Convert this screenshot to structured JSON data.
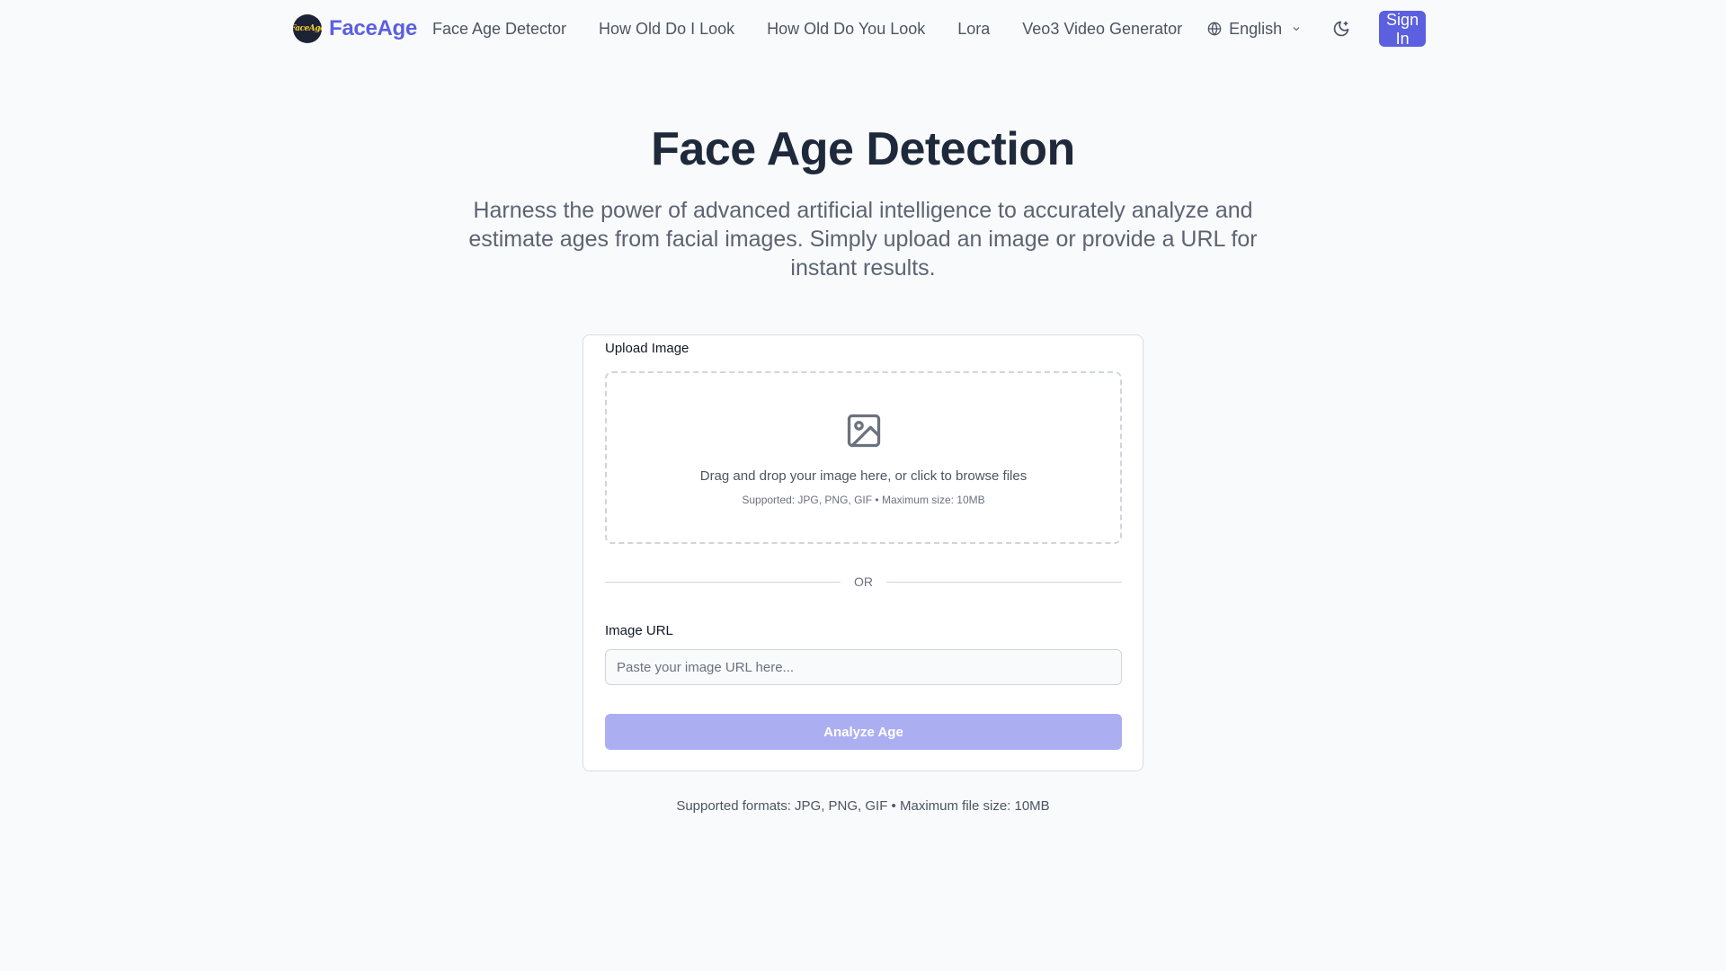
{
  "nav": {
    "logo_mark_text": "FaceAge",
    "logo_text": "FaceAge",
    "links": [
      {
        "label": "Face Age Detector"
      },
      {
        "label": "How Old Do I Look"
      },
      {
        "label": "How Old Do You Look"
      },
      {
        "label": "Lora"
      },
      {
        "label": "Veo3 Video Generator"
      }
    ],
    "language": "English",
    "sign_in": "Sign In",
    "icons": {
      "language": "globe-icon",
      "dropdown": "chevron-down-icon",
      "theme": "moon-icon"
    }
  },
  "hero": {
    "title": "Face Age Detection",
    "description": "Harness the power of advanced artificial intelligence to accurately analyze and estimate ages from facial images. Simply upload an image or provide a URL for instant results."
  },
  "upload": {
    "label": "Upload Image",
    "drop_text": "Drag and drop your image here, or click to browse files",
    "drop_subtext": "Supported: JPG, PNG, GIF • Maximum size: 10MB",
    "icon": "image-icon",
    "divider": "OR",
    "url_label": "Image URL",
    "url_value": "",
    "url_placeholder": "Paste your image URL here...",
    "analyze_button": "Analyze Age"
  },
  "footnote": "Supported formats: JPG, PNG, GIF • Maximum file size: 10MB",
  "colors": {
    "accent": "#5b5fe0",
    "button_disabled": "#abaff2",
    "background": "#f9fafb"
  }
}
